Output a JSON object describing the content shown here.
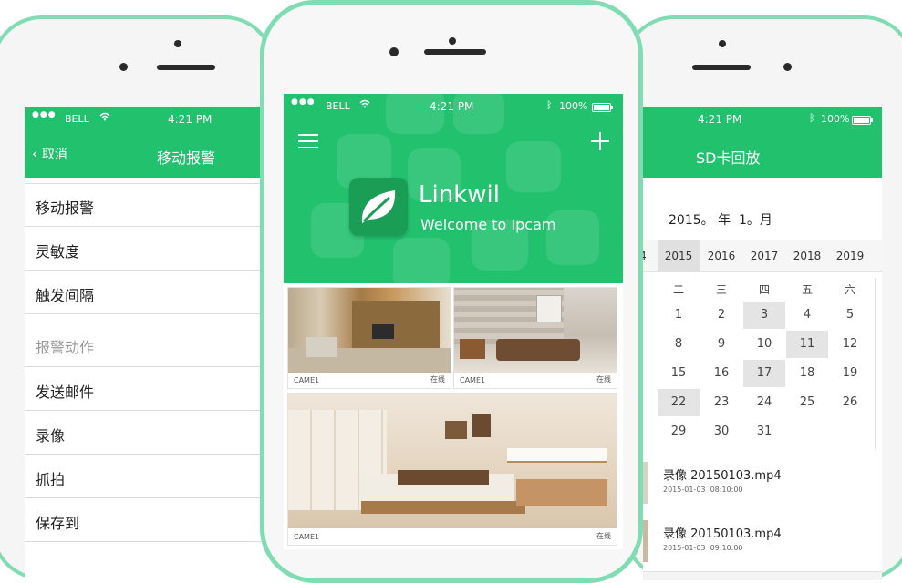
{
  "brand_color": "#22c16e",
  "status": {
    "carrier": "BELL",
    "time": "4:21 PM",
    "battery": "100%"
  },
  "left_phone": {
    "back_label": "取消",
    "title": "移动报警",
    "items": [
      {
        "label": "移动报警",
        "muted": false
      },
      {
        "label": "灵敏度",
        "muted": false
      },
      {
        "label": "触发间隔",
        "muted": false
      },
      {
        "label": "报警动作",
        "muted": true
      },
      {
        "label": "发送邮件",
        "muted": false
      },
      {
        "label": "录像",
        "muted": false
      },
      {
        "label": "抓拍",
        "muted": false
      },
      {
        "label": "保存到",
        "muted": false
      }
    ]
  },
  "center_phone": {
    "app_name": "Linkwil",
    "welcome": "Welcome to Ipcam",
    "cameras": [
      {
        "name": "CAME1",
        "status": "在线"
      },
      {
        "name": "CAME1",
        "status": "在线"
      },
      {
        "name": "CAME1",
        "status": "在线"
      }
    ]
  },
  "right_phone": {
    "title": "SD卡回放",
    "date_picker": "2015。 年  1。月",
    "years": [
      "4",
      "2015",
      "2016",
      "2017",
      "2018",
      "2019"
    ],
    "weekdays": [
      "二",
      "三",
      "四",
      "五",
      "六"
    ],
    "days": [
      [
        "1",
        "2",
        "3",
        "4",
        "5"
      ],
      [
        "8",
        "9",
        "10",
        "11",
        "12"
      ],
      [
        "15",
        "16",
        "17",
        "18",
        "19"
      ],
      [
        "22",
        "23",
        "24",
        "25",
        "26"
      ],
      [
        "29",
        "30",
        "31",
        "",
        ""
      ]
    ],
    "recordings": [
      {
        "title": "录像 20150103.mp4",
        "time": "2015-01-03  08:10:00"
      },
      {
        "title": "录像 20150103.mp4",
        "time": "2015-01-03  09:10:00"
      }
    ]
  }
}
